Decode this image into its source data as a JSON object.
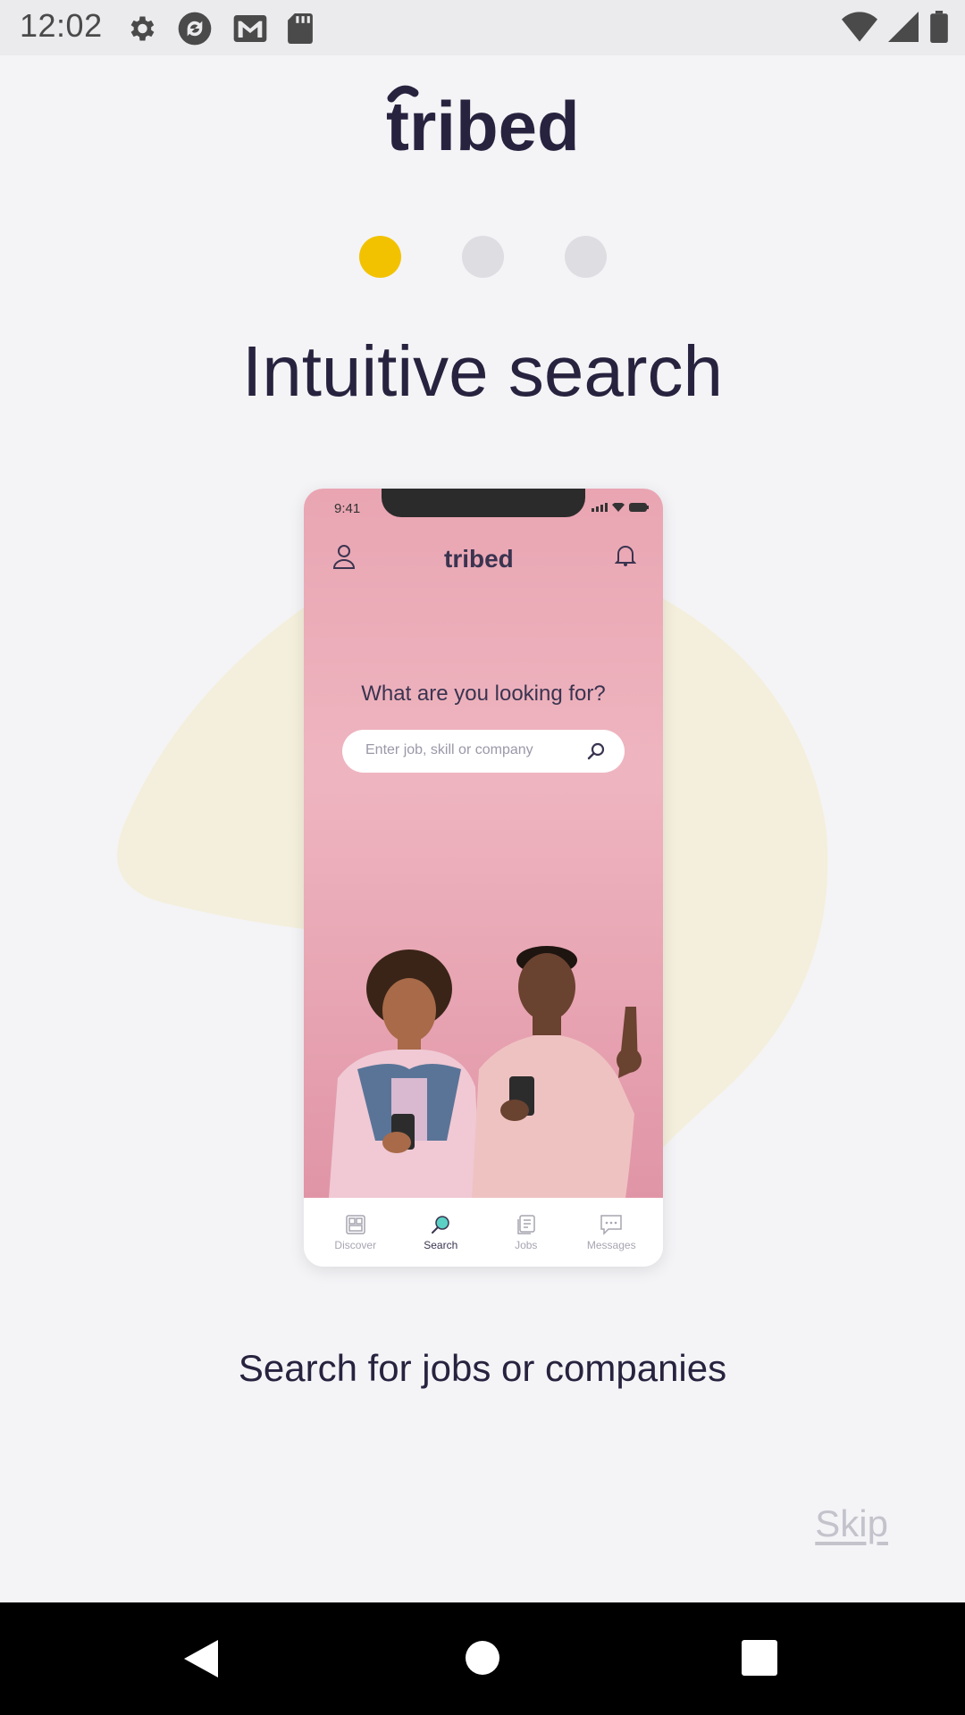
{
  "status_bar": {
    "time": "12:02",
    "left_icons": [
      "gear-icon",
      "sync-icon",
      "mail-icon",
      "sd-card-icon"
    ],
    "right_icons": [
      "wifi-icon",
      "signal-icon",
      "battery-icon"
    ]
  },
  "app": {
    "logo_text": "tribed",
    "brand_color": "#27233f",
    "accent_color": "#f2c200"
  },
  "onboarding": {
    "pages_total": 3,
    "current_page": 1,
    "title": "Intuitive search",
    "subtitle": "Search for jobs or companies",
    "skip_label": "Skip"
  },
  "phone_mockup": {
    "time": "9:41",
    "logo_text": "tribed",
    "question": "What are you looking for?",
    "search_placeholder": "Enter job, skill or company",
    "nav_items": [
      {
        "label": "Discover",
        "icon": "discover-icon",
        "active": false
      },
      {
        "label": "Search",
        "icon": "search-icon",
        "active": true
      },
      {
        "label": "Jobs",
        "icon": "jobs-icon",
        "active": false
      },
      {
        "label": "Messages",
        "icon": "messages-icon",
        "active": false
      }
    ]
  },
  "system_nav": {
    "buttons": [
      "back-icon",
      "home-icon",
      "recents-icon"
    ]
  }
}
